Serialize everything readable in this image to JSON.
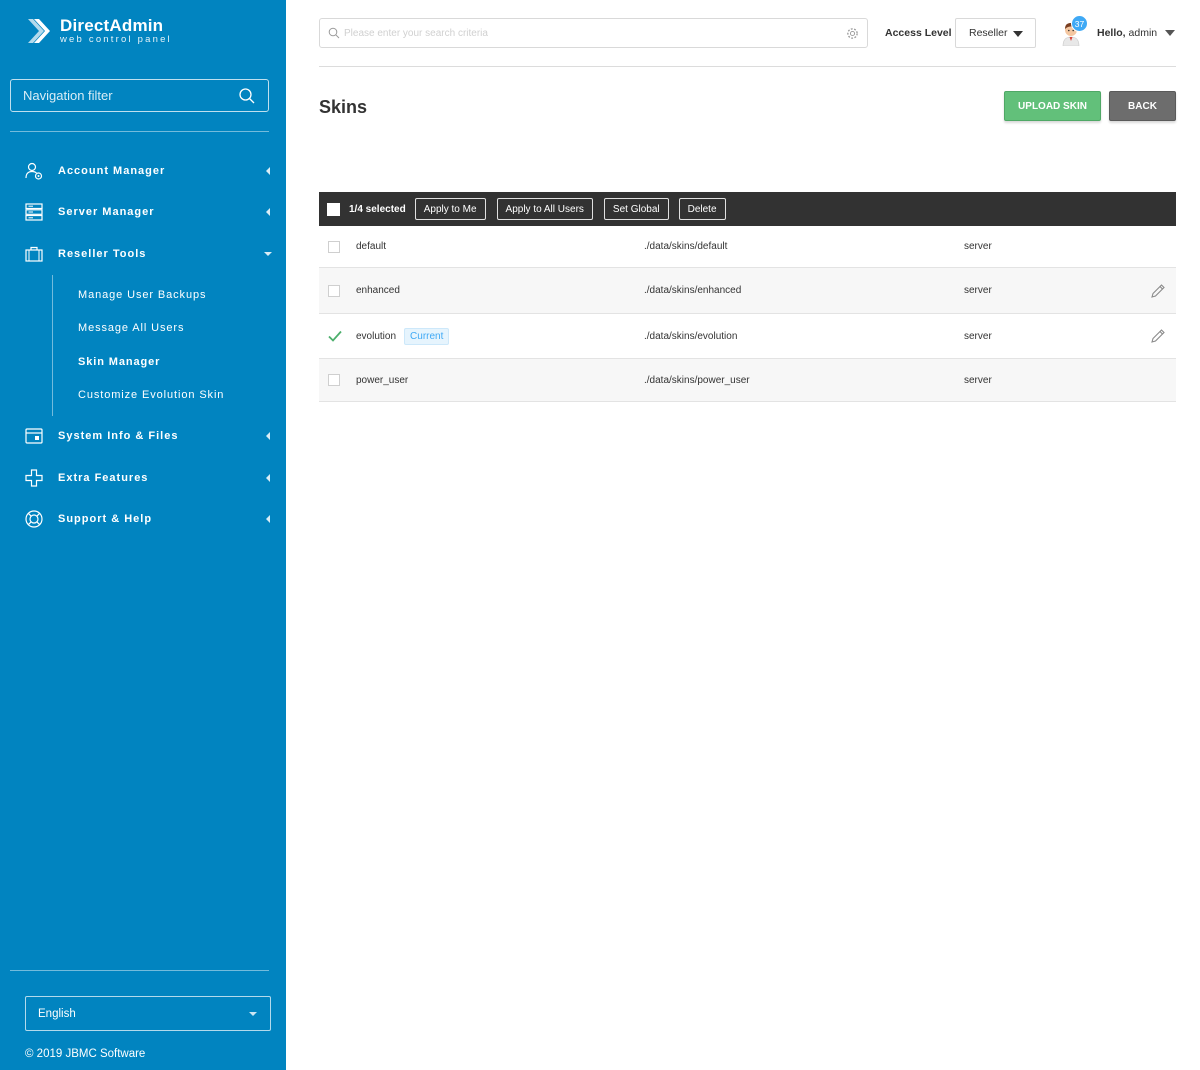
{
  "brand": {
    "title": "DirectAdmin",
    "subtitle": "web control panel"
  },
  "sidebar": {
    "filter_placeholder": "Navigation filter",
    "items": [
      {
        "label": "Account Manager",
        "icon": "users-icon",
        "state": "collapsed"
      },
      {
        "label": "Server Manager",
        "icon": "server-icon",
        "state": "collapsed"
      },
      {
        "label": "Reseller Tools",
        "icon": "briefcase-icon",
        "state": "expanded"
      },
      {
        "label": "System Info & Files",
        "icon": "folder-icon",
        "state": "collapsed"
      },
      {
        "label": "Extra Features",
        "icon": "plus-icon",
        "state": "collapsed"
      },
      {
        "label": "Support & Help",
        "icon": "lifebuoy-icon",
        "state": "collapsed"
      }
    ],
    "subitems": [
      {
        "label": "Manage User Backups"
      },
      {
        "label": "Message All Users"
      },
      {
        "label": "Skin Manager",
        "active": true
      },
      {
        "label": "Customize Evolution Skin"
      }
    ],
    "language": "English",
    "copyright": "© 2019 JBMC Software"
  },
  "header": {
    "search_placeholder": "Please enter your search criteria",
    "access_level_label": "Access Level",
    "access_level_value": "Reseller",
    "notifications": "37",
    "hello": "Hello,",
    "username": "admin"
  },
  "page": {
    "title": "Skins",
    "upload_label": "UPLOAD SKIN",
    "back_label": "BACK"
  },
  "table": {
    "selected_text": "1/4 selected",
    "actions": [
      "Apply to Me",
      "Apply to All Users",
      "Set Global",
      "Delete"
    ],
    "rows": [
      {
        "name": "default",
        "path": "./data/skins/default",
        "level": "server",
        "checked": false,
        "current": false,
        "editable": false
      },
      {
        "name": "enhanced",
        "path": "./data/skins/enhanced",
        "level": "server",
        "checked": false,
        "current": false,
        "editable": true
      },
      {
        "name": "evolution",
        "path": "./data/skins/evolution",
        "level": "server",
        "checked": true,
        "current": true,
        "current_label": "Current",
        "editable": true
      },
      {
        "name": "power_user",
        "path": "./data/skins/power_user",
        "level": "server",
        "checked": false,
        "current": false,
        "editable": false
      }
    ]
  },
  "colors": {
    "sidebar": "#0184c0",
    "upload": "#62c07a",
    "back": "#6d6d6d",
    "toolbar": "#323232",
    "accent": "#3fa9f5"
  }
}
